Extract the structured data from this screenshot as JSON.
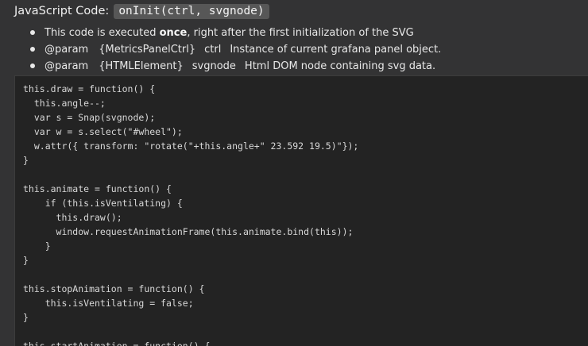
{
  "header": {
    "label": "JavaScript Code:",
    "function_signature": "onInit(ctrl, svgnode)"
  },
  "bullets": [
    {
      "prefix": "This code is executed ",
      "emphasis": "once",
      "suffix": ", right after the first initialization of the SVG"
    },
    {
      "tag": "@param",
      "type": "{MetricsPanelCtrl}",
      "name": "ctrl",
      "description": "Instance of current grafana panel object."
    },
    {
      "tag": "@param",
      "type": "{HTMLElement}",
      "name": "svgnode",
      "description": "Html DOM node containing svg data."
    }
  ],
  "code_lines": [
    "this.draw = function() {",
    "  this.angle--;",
    "  var s = Snap(svgnode);",
    "  var w = s.select(\"#wheel\");",
    "  w.attr({ transform: \"rotate(\"+this.angle+\" 23.592 19.5)\"});",
    "}",
    "",
    "this.animate = function() {",
    "    if (this.isVentilating) {",
    "      this.draw();",
    "      window.requestAnimationFrame(this.animate.bind(this));",
    "    }",
    "}",
    "",
    "this.stopAnimation = function() {",
    "    this.isVentilating = false;",
    "}",
    "",
    "this.startAnimation = function() {"
  ]
}
